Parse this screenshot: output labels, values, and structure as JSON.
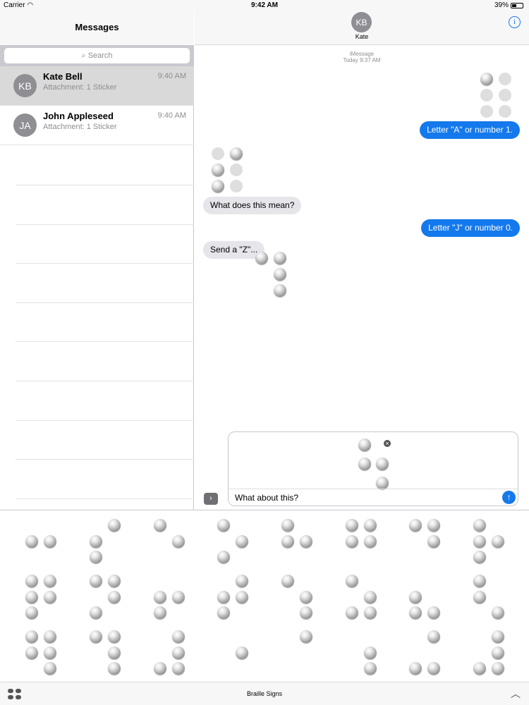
{
  "status_bar": {
    "carrier": "Carrier",
    "time": "9:42 AM",
    "battery": "39%"
  },
  "sidebar": {
    "title": "Messages",
    "search_placeholder": "Search",
    "conversations": [
      {
        "initials": "KB",
        "name": "Kate Bell",
        "preview": "Attachment: 1 Sticker",
        "time": "9:40 AM",
        "selected": true
      },
      {
        "initials": "JA",
        "name": "John Appleseed",
        "preview": "Attachment: 1 Sticker",
        "time": "9:40 AM",
        "selected": false
      }
    ]
  },
  "chat": {
    "contact_initials": "KB",
    "contact_name": "Kate",
    "service": "iMessage",
    "timestamp": "Today 9:37 AM",
    "messages": [
      {
        "from": "me",
        "type": "sticker",
        "dots": [
          1,
          0,
          0,
          0,
          0,
          0
        ]
      },
      {
        "from": "me",
        "type": "text",
        "text": "Letter \"A\" or number 1."
      },
      {
        "from": "them",
        "type": "sticker",
        "dots": [
          0,
          1,
          1,
          1,
          0,
          0
        ]
      },
      {
        "from": "them",
        "type": "text",
        "text": "What does this mean?"
      },
      {
        "from": "me",
        "type": "text",
        "text": "Letter \"J\" or number 0."
      },
      {
        "from": "them",
        "type": "text",
        "text": "Send a \"Z\"..."
      },
      {
        "from": "them",
        "type": "sticker",
        "dots": [
          1,
          0,
          0,
          1,
          1,
          1
        ]
      }
    ],
    "compose_text": "What about this?",
    "compose_sticker_dots": [
      1,
      1,
      0,
      0,
      1,
      1
    ]
  },
  "drawer": {
    "title": "Braille Signs",
    "stickers": [
      [
        0,
        1,
        0,
        0,
        1,
        0
      ],
      [
        0,
        1,
        1,
        1,
        0,
        0
      ],
      [
        1,
        0,
        0,
        0,
        1,
        0
      ],
      [
        1,
        0,
        1,
        0,
        1,
        0
      ],
      [
        1,
        1,
        0,
        0,
        1,
        0
      ],
      [
        1,
        1,
        0,
        1,
        1,
        0
      ],
      [
        1,
        0,
        0,
        1,
        1,
        0
      ],
      [
        1,
        1,
        1,
        0,
        1,
        0
      ],
      [
        1,
        1,
        1,
        1,
        1,
        0
      ],
      [
        1,
        0,
        1,
        1,
        1,
        0
      ],
      [
        0,
        1,
        1,
        0,
        1,
        0
      ],
      [
        0,
        1,
        1,
        1,
        1,
        0
      ],
      [
        1,
        0,
        0,
        0,
        1,
        1
      ],
      [
        1,
        0,
        1,
        0,
        1,
        1
      ],
      [
        0,
        1,
        1,
        0,
        0,
        1
      ],
      [
        1,
        1,
        0,
        0,
        0,
        1
      ],
      [
        1,
        1,
        0,
        1,
        1,
        1
      ],
      [
        1,
        0,
        0,
        1,
        1,
        1
      ],
      [
        0,
        0,
        1,
        1,
        1,
        1
      ],
      [
        0,
        0,
        0,
        0,
        1,
        0
      ],
      [
        0,
        0,
        0,
        1,
        0,
        0
      ],
      [
        0,
        0,
        0,
        0,
        1,
        1
      ],
      [
        0,
        0,
        1,
        1,
        0,
        1
      ],
      [
        0,
        0,
        1,
        1,
        1,
        1
      ]
    ]
  }
}
